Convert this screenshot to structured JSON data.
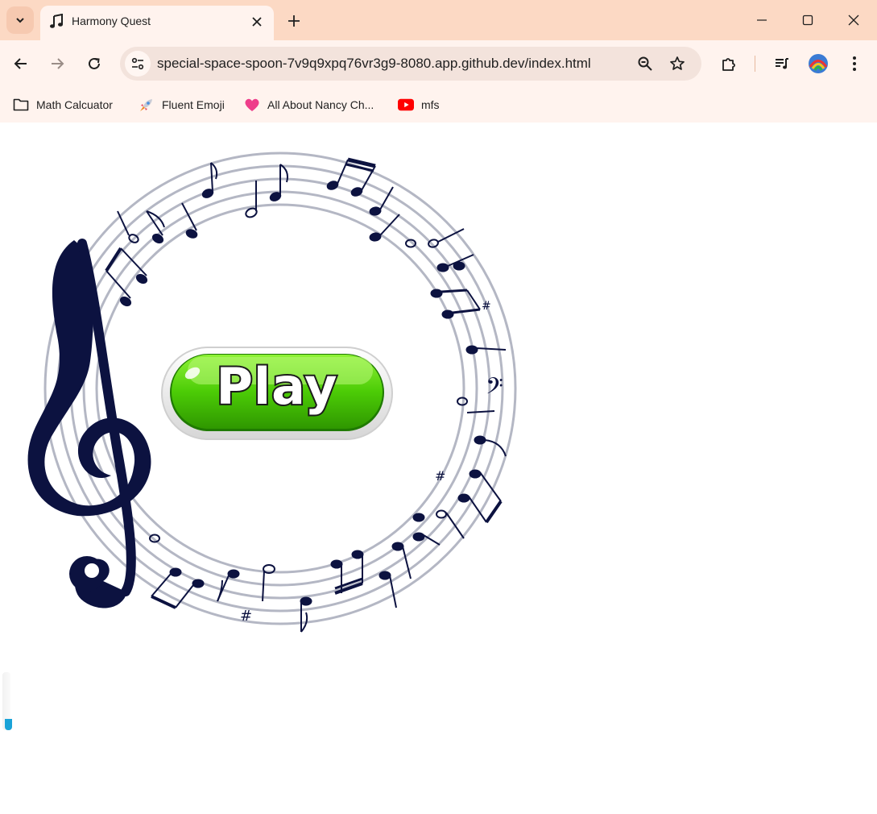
{
  "browser": {
    "tab": {
      "title": "Harmony Quest"
    },
    "address_bar": {
      "url": "special-space-spoon-7v9q9xpq76vr3g9-8080.app.github.dev/index.html"
    },
    "bookmarks": [
      {
        "label": "Math Calcuator",
        "icon": "folder-icon"
      },
      {
        "label": "Fluent Emoji",
        "icon": "rocket-icon"
      },
      {
        "label": "All About Nancy Ch...",
        "icon": "heart-icon"
      },
      {
        "label": "mfs",
        "icon": "youtube-icon"
      }
    ]
  },
  "game": {
    "play_label": "Play",
    "loading_progress": 0.2
  },
  "colors": {
    "tabstrip": "#fcd9c4",
    "toolbar": "#fff3ee",
    "play_green": "#4ccc06",
    "treble_clef": "#0c1240",
    "staff_lines": "#b4b7c4",
    "progress": "#1aa3d8"
  }
}
